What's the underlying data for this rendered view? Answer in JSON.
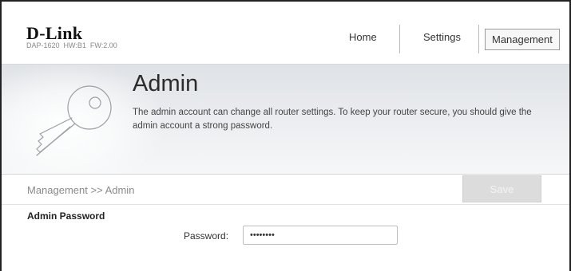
{
  "header": {
    "logo_text": "D-Link",
    "model_info": "DAP-1620  HW:B1  FW:2.00",
    "nav": {
      "home": "Home",
      "settings": "Settings",
      "management": "Management",
      "active": "management"
    }
  },
  "banner": {
    "icon": "key-icon",
    "title": "Admin",
    "description": "The admin account can change all router settings. To keep your router secure, you should give the admin account a strong password."
  },
  "breadcrumb": "Management >> Admin",
  "toolbar": {
    "save_label": "Save"
  },
  "section": {
    "title": "Admin Password",
    "password_label": "Password:",
    "password_value": "••••••••"
  }
}
